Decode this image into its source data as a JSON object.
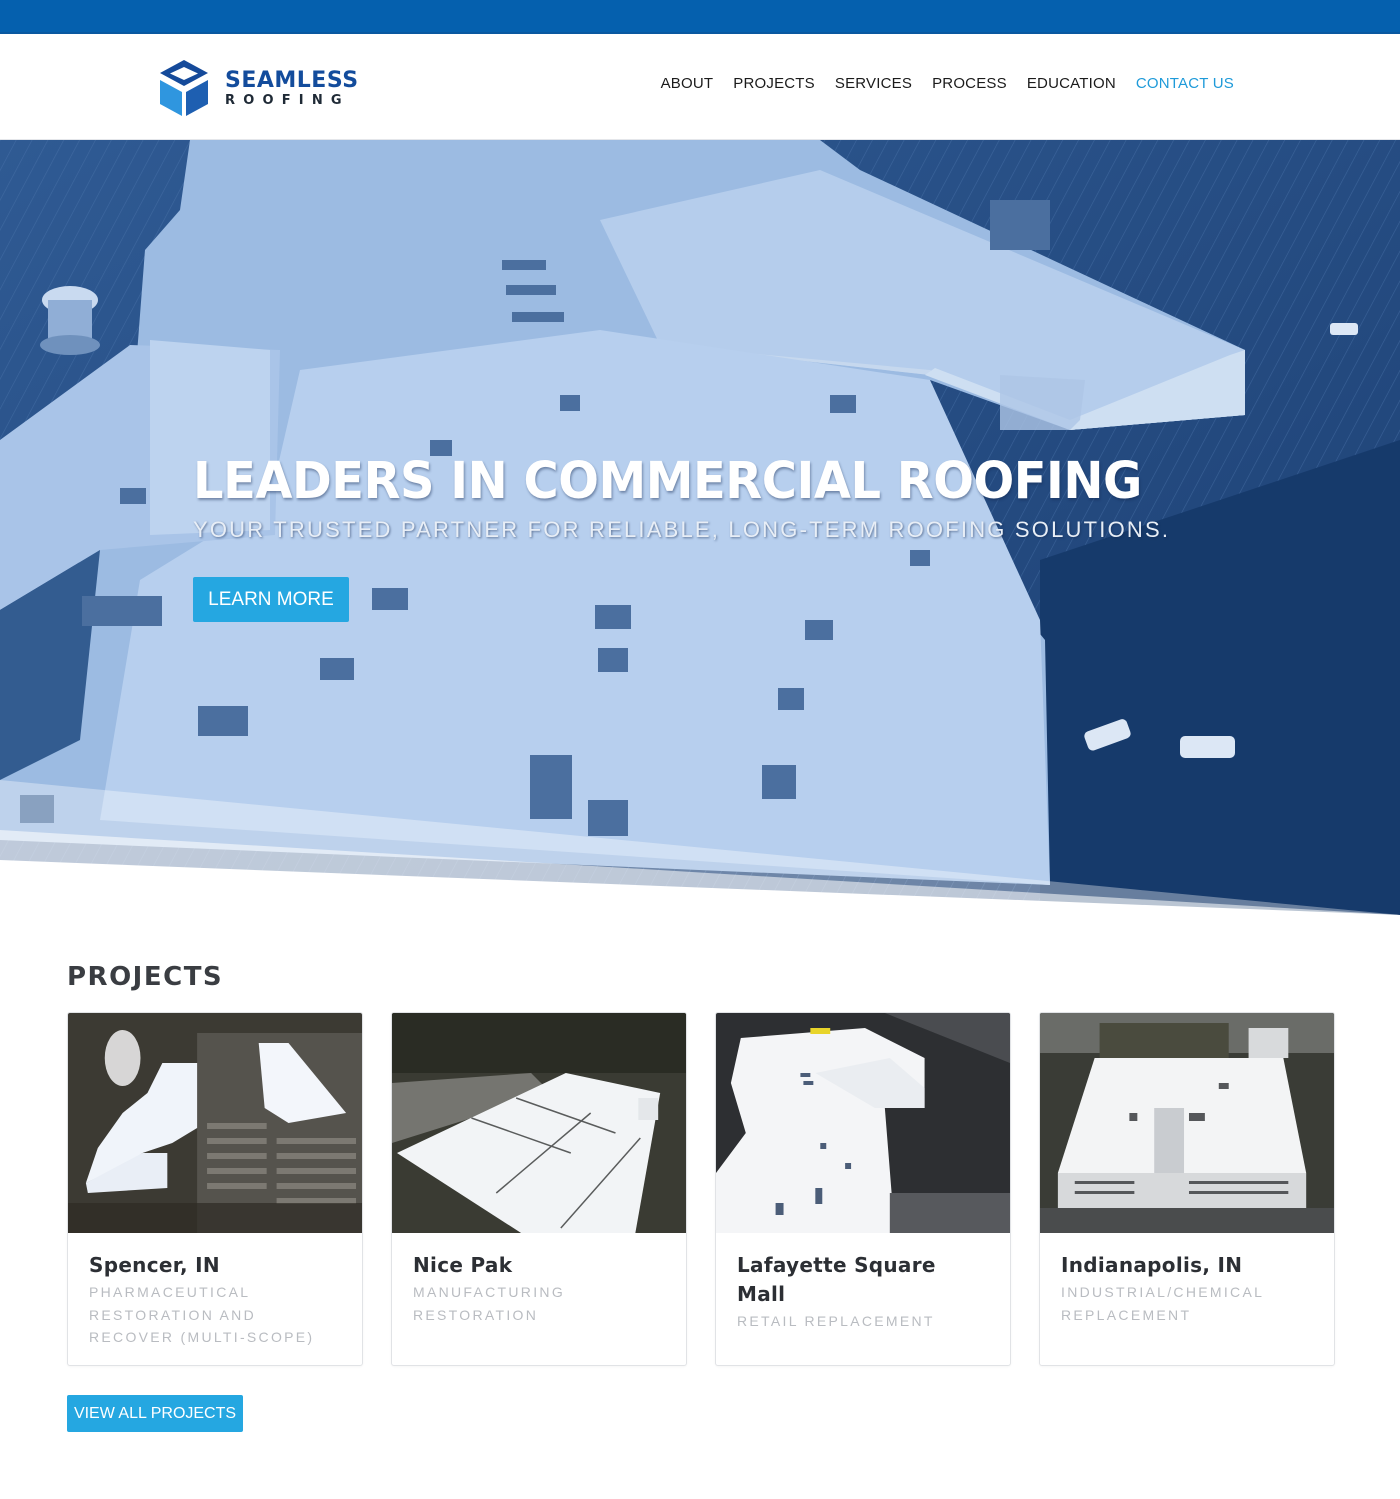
{
  "brand": {
    "name_line1": "SEAMLESS",
    "name_line2": "ROOFING",
    "colors": {
      "top_bar": "#0560ae",
      "logo_blue": "#134c9c",
      "accent": "#25a7e1",
      "nav_active": "#1e9ad9"
    }
  },
  "nav": {
    "items": [
      {
        "label": "ABOUT",
        "active": false
      },
      {
        "label": "PROJECTS",
        "active": false
      },
      {
        "label": "SERVICES",
        "active": false
      },
      {
        "label": "PROCESS",
        "active": false
      },
      {
        "label": "EDUCATION",
        "active": false
      },
      {
        "label": "CONTACT US",
        "active": true
      }
    ]
  },
  "hero": {
    "title": "LEADERS IN COMMERCIAL ROOFING",
    "subtitle": "YOUR TRUSTED PARTNER FOR RELIABLE, LONG-TERM ROOFING SOLUTIONS.",
    "cta_label": "LEARN MORE",
    "image_description": "aerial view of large white commercial roof with blue overlay"
  },
  "projects": {
    "heading": "PROJECTS",
    "items": [
      {
        "title": "Spencer, IN",
        "subtitle": "PHARMACEUTICAL RESTORATION AND RECOVER (MULTI-SCOPE)",
        "image": "aerial-pharmaceutical-campus"
      },
      {
        "title": "Nice Pak",
        "subtitle": "MANUFACTURING RESTORATION",
        "image": "aerial-manufacturing-plant"
      },
      {
        "title": "Lafayette Square Mall",
        "subtitle": "RETAIL REPLACEMENT",
        "image": "aerial-shopping-mall"
      },
      {
        "title": "Indianapolis, IN",
        "subtitle": "INDUSTRIAL/CHEMICAL REPLACEMENT",
        "image": "aerial-industrial-building"
      }
    ],
    "view_all_label": "VIEW ALL PROJECTS"
  }
}
